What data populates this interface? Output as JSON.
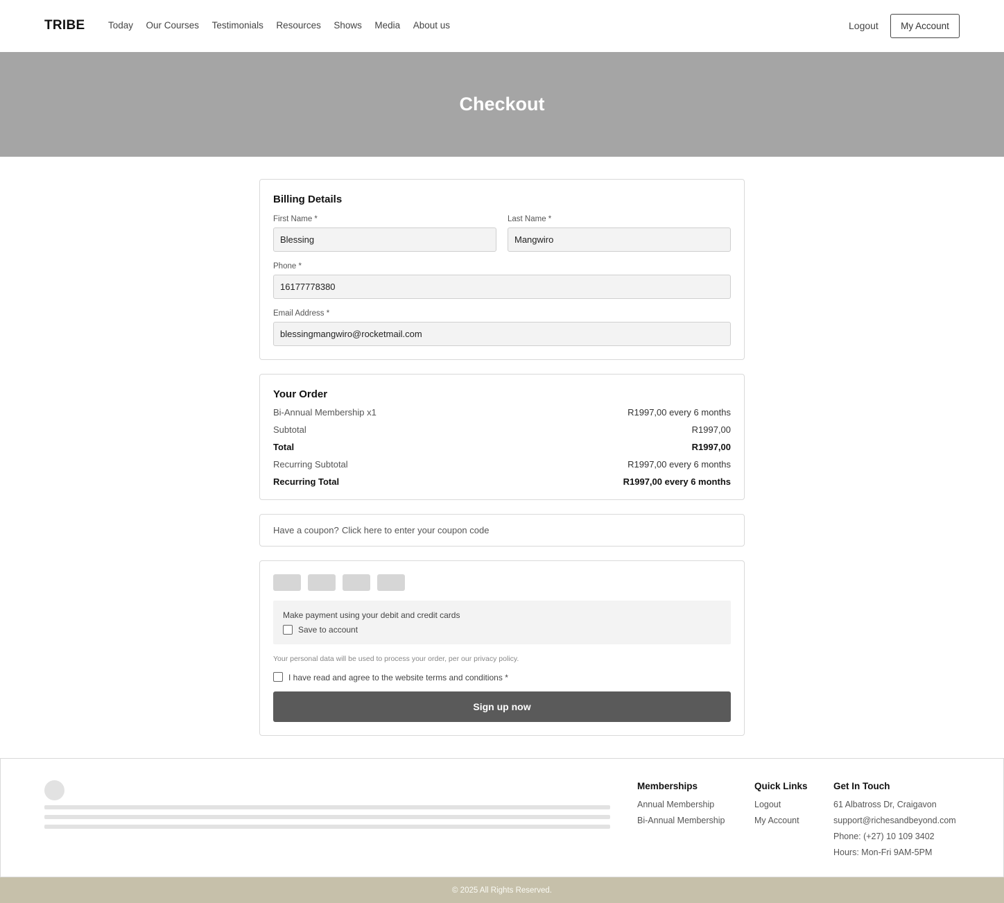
{
  "header": {
    "brand": "TRIBE",
    "nav": [
      "Today",
      "Our Courses",
      "Testimonials",
      "Resources",
      "Shows",
      "Media",
      "About us"
    ],
    "logout": "Logout",
    "account": "My Account"
  },
  "hero": {
    "title": "Checkout"
  },
  "billing": {
    "title": "Billing Details",
    "first_name_label": "First Name *",
    "first_name_value": "Blessing",
    "last_name_label": "Last Name *",
    "last_name_value": "Mangwiro",
    "phone_label": "Phone *",
    "phone_value": "16177778380",
    "email_label": "Email Address *",
    "email_value": "blessingmangwiro@rocketmail.com"
  },
  "order": {
    "title": "Your Order",
    "rows": [
      {
        "label": "Bi-Annual Membership x1",
        "value": "R1997,00 every 6 months"
      },
      {
        "label": "Subtotal",
        "value": "R1997,00"
      },
      {
        "label": "Total",
        "value": "R1997,00"
      },
      {
        "label": "Recurring Subtotal",
        "value": "R1997,00 every 6 months"
      },
      {
        "label": "Recurring Total",
        "value": "R1997,00 every 6 months"
      }
    ]
  },
  "coupon": {
    "prompt": "Have a coupon?",
    "link": "Click here to enter your coupon code"
  },
  "payment": {
    "description": "Make payment using your debit and credit cards",
    "save_label": "Save to account",
    "privacy": "Your personal data will be used to process your order, per our privacy policy.",
    "terms_label": "I have read and agree to the website terms and conditions *",
    "submit": "Sign up now"
  },
  "footer": {
    "memberships": {
      "title": "Memberships",
      "items": [
        "Annual Membership",
        "Bi-Annual Membership"
      ]
    },
    "quick_links": {
      "title": "Quick Links",
      "items": [
        "Logout",
        "My Account"
      ]
    },
    "contact": {
      "title": "Get In Touch",
      "items": [
        "61 Albatross Dr, Craigavon",
        "support@richesandbeyond.com",
        "Phone: (+27) 10 109 3402",
        "Hours: Mon-Fri 9AM-5PM"
      ]
    },
    "copyright": "© 2025 All Rights Reserved."
  }
}
